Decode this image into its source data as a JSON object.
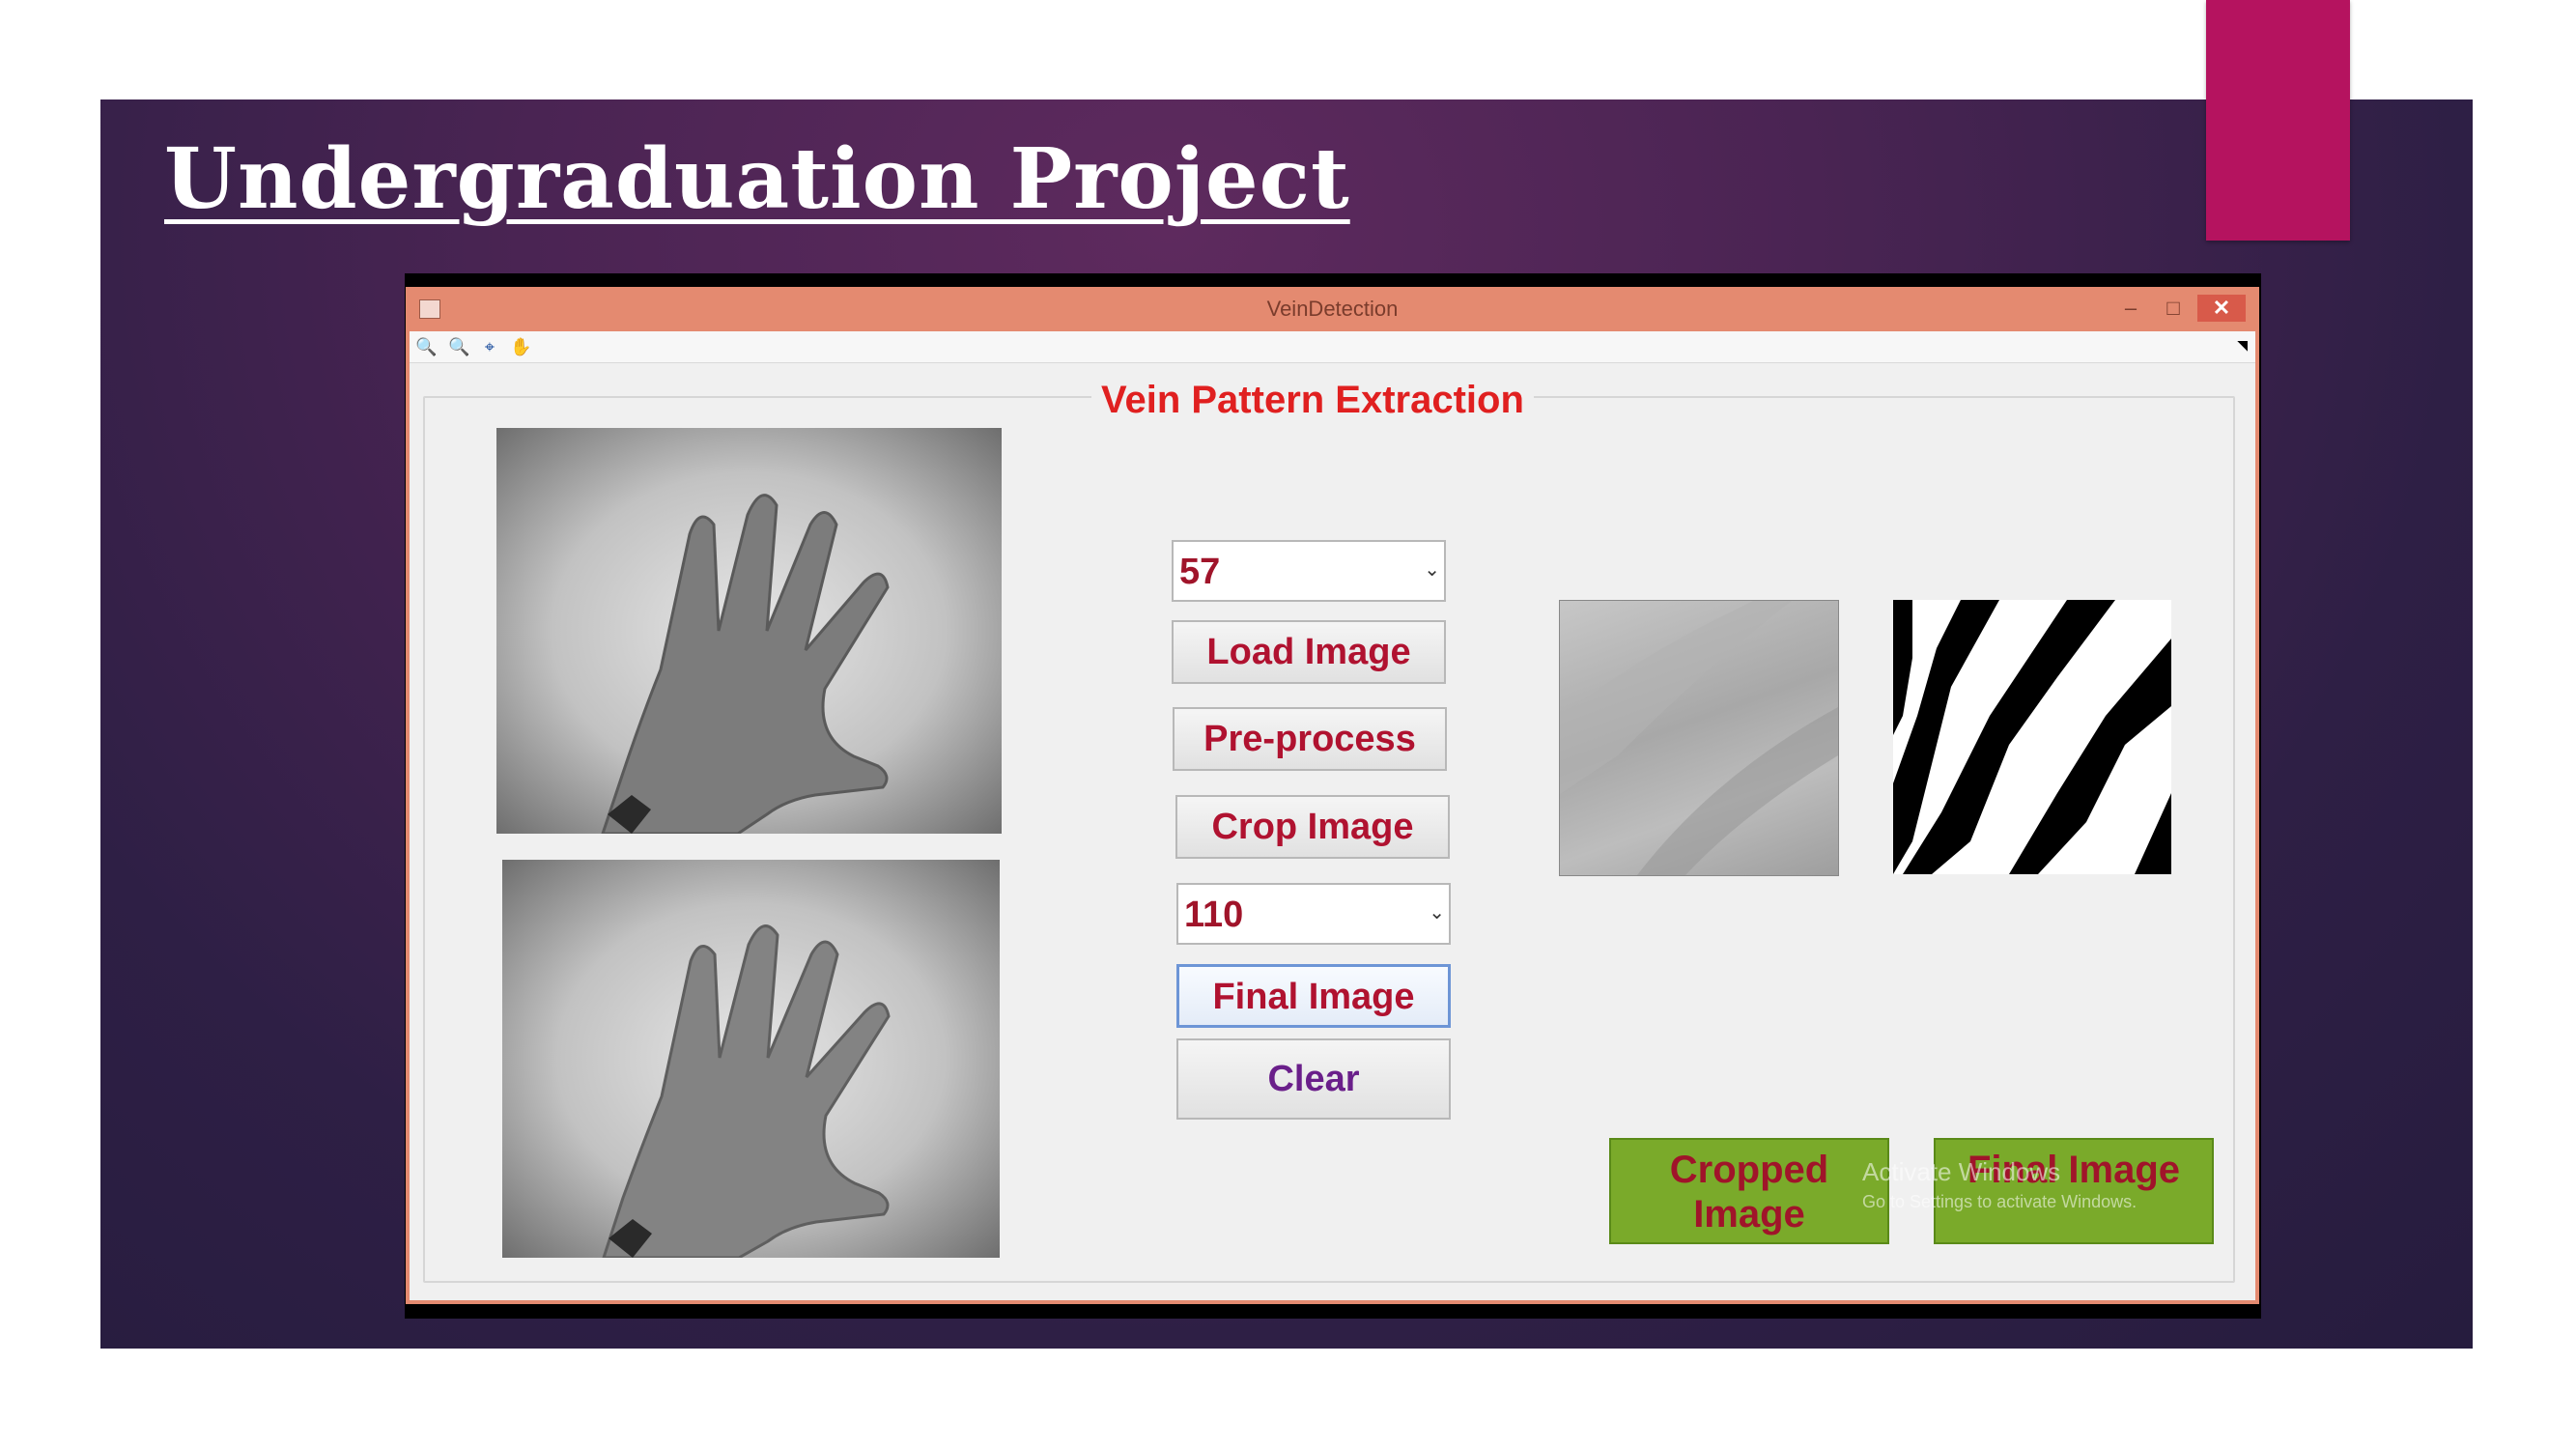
{
  "slide": {
    "title": "Undergraduation Project"
  },
  "window": {
    "title": "VeinDetection",
    "controls": {
      "minimize": "–",
      "maximize": "□",
      "close": "✕"
    },
    "toolbar": [
      {
        "icon": "zoom-in-icon",
        "glyph": "🔍"
      },
      {
        "icon": "zoom-out-icon",
        "glyph": "🔍"
      },
      {
        "icon": "data-cursor-icon",
        "glyph": "⌖"
      },
      {
        "icon": "pan-hand-icon",
        "glyph": "✋"
      }
    ]
  },
  "panel": {
    "title": "Vein Pattern Extraction",
    "combo1": {
      "value": "57"
    },
    "combo2": {
      "value": "110"
    },
    "buttons": {
      "load": "Load Image",
      "preprocess": "Pre-process",
      "crop": "Crop Image",
      "final": "Final Image",
      "clear": "Clear"
    },
    "result_buttons": {
      "cropped": "Cropped Image",
      "final": "Final Image"
    }
  },
  "watermark": {
    "line1": "Activate Windows",
    "line2": "Go to Settings to activate Windows."
  },
  "colors": {
    "accent": "#b5135f",
    "titlebar": "#e48a70",
    "panel_title": "#e02020",
    "button_text": "#b01230",
    "result_button_bg": "#7aaa2a"
  }
}
